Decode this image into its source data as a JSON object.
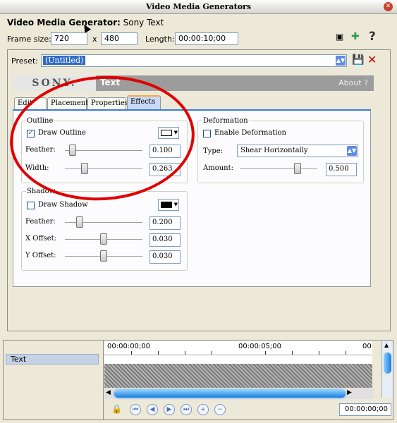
{
  "window": {
    "title": "Video Media Generators"
  },
  "header": {
    "label": "Video Media Generator:",
    "generator": "Sony Text"
  },
  "frame": {
    "size_label": "Frame size:",
    "width": "720",
    "x_label": "x",
    "height": "480",
    "length_label": "Length:",
    "length": "00:00:10;00"
  },
  "preset": {
    "label": "Preset:",
    "value": "(Untitled)"
  },
  "banner": {
    "logo": "SONY.",
    "plugin": "Text",
    "about": "About ?"
  },
  "tabs": [
    "Edit",
    "Placement",
    "Properties",
    "Effects"
  ],
  "outline": {
    "legend": "Outline",
    "draw_label": "Draw Outline",
    "draw_checked": true,
    "feather_label": "Feather:",
    "feather": "0.100",
    "width_label": "Width:",
    "width": "0.263",
    "color": "#ffffff"
  },
  "shadow": {
    "legend": "Shadow",
    "draw_label": "Draw Shadow",
    "draw_checked": false,
    "feather_label": "Feather:",
    "feather": "0.200",
    "xoffset_label": "X Offset:",
    "xoffset": "0.030",
    "yoffset_label": "Y Offset:",
    "yoffset": "0.030",
    "color": "#000000"
  },
  "deformation": {
    "legend": "Deformation",
    "enable_label": "Enable Deformation",
    "enabled": false,
    "type_label": "Type:",
    "type": "Shear Horizontally",
    "amount_label": "Amount:",
    "amount": "0.500"
  },
  "timeline": {
    "track": "Text",
    "tc0": "00:00:00;00",
    "tc5": "00:00:05;00",
    "tc10": "00",
    "current": "00:00:00;00"
  }
}
